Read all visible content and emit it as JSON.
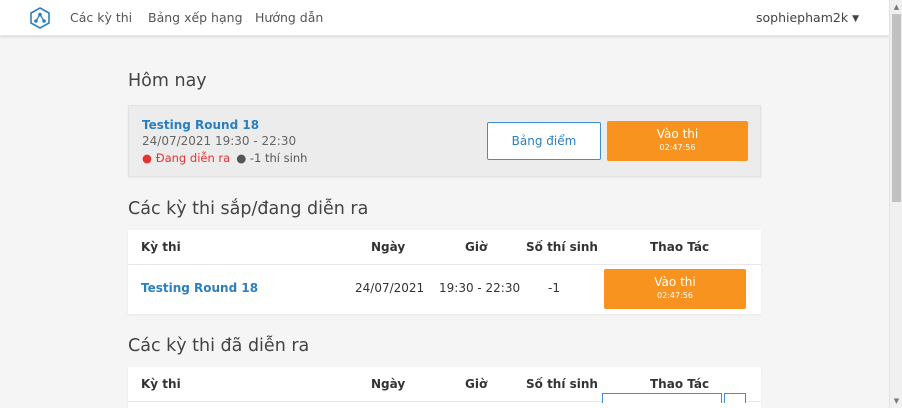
{
  "nav": {
    "links": [
      "Các kỳ thi",
      "Bảng xếp hạng",
      "Hướng dẫn"
    ],
    "user": "sophiepham2k"
  },
  "today": {
    "heading": "Hôm nay",
    "contest_name": "Testing Round 18",
    "time": "24/07/2021 19:30 - 22:30",
    "status": "● Đang diễn ra",
    "participants": "● -1 thí sinh",
    "scoreboard_button": "Bảng điểm",
    "enter_button": "Vào thi",
    "countdown": "02:47:56"
  },
  "upcoming": {
    "heading": "Các kỳ thi sắp/đang diễn ra",
    "columns": [
      "Kỳ thi",
      "Ngày",
      "Giờ",
      "Số thí sinh",
      "Thao Tác"
    ],
    "rows": [
      {
        "name": "Testing Round 18",
        "date": "24/07/2021",
        "time": "19:30 - 22:30",
        "participants": "-1",
        "action": "Vào thi",
        "countdown": "02:47:56"
      }
    ]
  },
  "past": {
    "heading": "Các kỳ thi đã diễn ra",
    "columns": [
      "Kỳ thi",
      "Ngày",
      "Giờ",
      "Số thí sinh",
      "Thao Tác"
    ]
  },
  "colors": {
    "accent_orange": "#f7931e",
    "link_blue": "#2a7fc0",
    "live_red": "#e3342f"
  }
}
